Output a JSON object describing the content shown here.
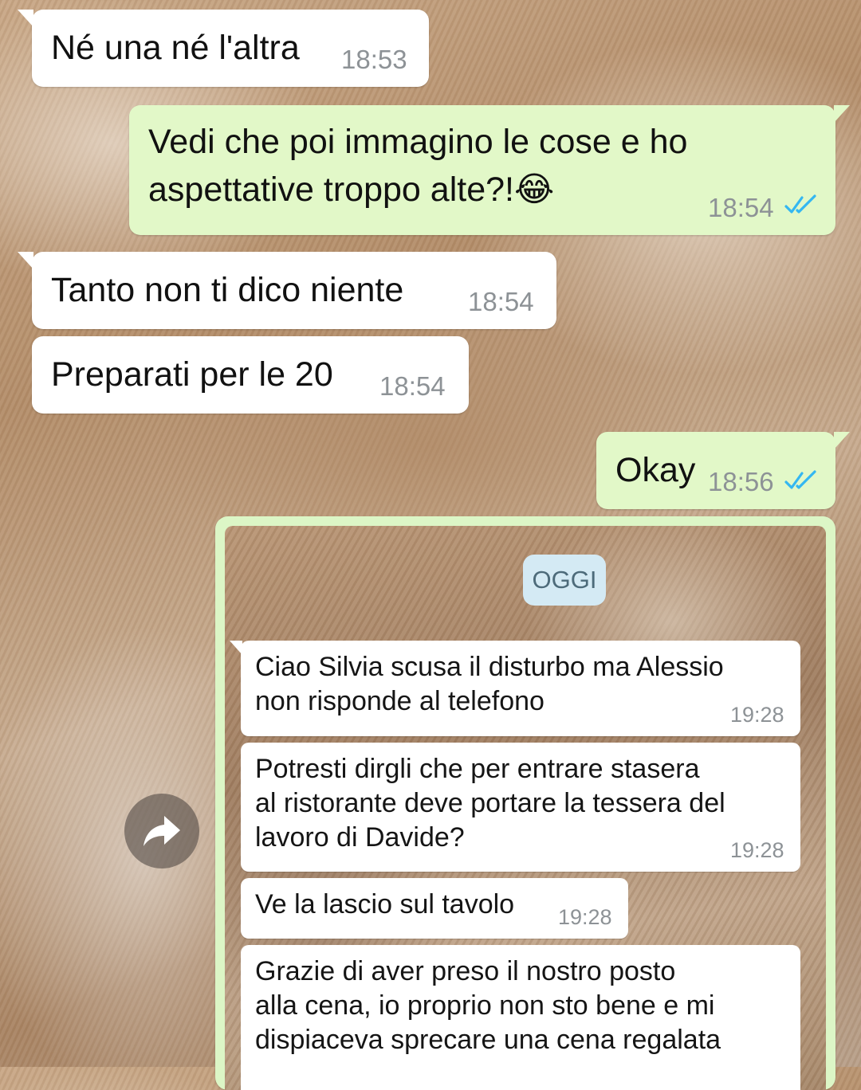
{
  "messages": [
    {
      "text": "Né una né l'altra",
      "time": "18:53"
    },
    {
      "text_line1": "Vedi che poi immagino le cose e ho",
      "text_line2": "aspettative troppo alte?!",
      "emoji": "😂",
      "time": "18:54",
      "status": "read"
    },
    {
      "text": "Tanto non ti dico niente",
      "time": "18:54"
    },
    {
      "text": "Preparati per le 20",
      "time": "18:54"
    },
    {
      "text": "Okay",
      "time": "18:56",
      "status": "read"
    }
  ],
  "forwarded_image": {
    "date_chip": "OGGI",
    "messages": [
      {
        "line1": "Ciao Silvia scusa il disturbo ma Alessio",
        "line2": "non risponde al telefono",
        "time": "19:28"
      },
      {
        "line1": "Potresti dirgli che per entrare stasera",
        "line2": "al ristorante deve portare la tessera del",
        "line3": "lavoro di Davide?",
        "time": "19:28"
      },
      {
        "line1": "Ve la lascio sul tavolo",
        "time": "19:28"
      },
      {
        "line1": "Grazie di aver preso il nostro posto",
        "line2": "alla cena, io proprio non sto bene e mi",
        "line3": "dispiaceva sprecare una cena regalata"
      }
    ]
  },
  "icons": {
    "forward": "forward-arrow-icon",
    "read_receipt": "double-check-icon"
  },
  "colors": {
    "incoming": "#ffffff",
    "outgoing": "#e2f8c8",
    "read_tick": "#34b7f1",
    "date_chip": "#d4eaf4"
  }
}
